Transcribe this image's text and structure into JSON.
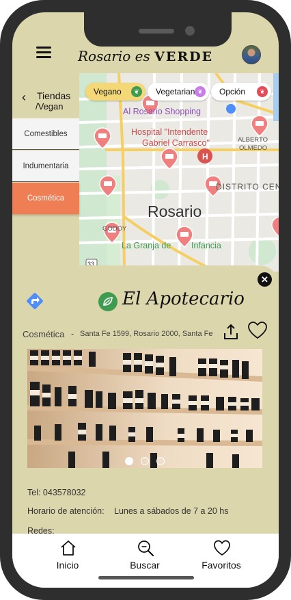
{
  "header": {
    "title_script": "Rosario es",
    "title_bold": "VERDE"
  },
  "filters": [
    {
      "label": "Vegano",
      "color": "#f4d776",
      "icon_color": "#3e9b4f",
      "icon": "leaf-icon"
    },
    {
      "label": "Vegetariano",
      "color": "#ffffff",
      "icon_color": "#c77ce8",
      "icon": "leaf-icon"
    },
    {
      "label": "Opción",
      "color": "#ffffff",
      "icon_color": "#e24b57",
      "icon": "leaf-icon"
    }
  ],
  "sidebar": {
    "back_label": "Tiendas",
    "sub_label": "/Vegan",
    "items": [
      {
        "label": "Comestibles",
        "active": false
      },
      {
        "label": "Indumentaria",
        "active": false
      },
      {
        "label": "Cosmética",
        "active": true
      }
    ]
  },
  "map": {
    "labels": [
      {
        "text": "Al Rosario Shopping",
        "color": "#8c4db3"
      },
      {
        "text": "Hospital \"Intendente",
        "color": "#c94a4a"
      },
      {
        "text": "Gabriel Carrasco\"",
        "color": "#c94a4a"
      },
      {
        "text": "ALBERTO",
        "color": "#555555"
      },
      {
        "text": "OLMEDO",
        "color": "#555555"
      },
      {
        "text": "DISTRITO CEN",
        "color": "#555555"
      },
      {
        "text": "Rosario",
        "color": "#333333"
      },
      {
        "text": "GODOY",
        "color": "#555555"
      },
      {
        "text": "La Granja de",
        "color": "#3e9b4f"
      },
      {
        "text": "Infancia",
        "color": "#3e9b4f"
      },
      {
        "text": "33",
        "color": "#333333"
      }
    ],
    "pin_color": "#f08080",
    "road_color": "#f6cf62"
  },
  "shop": {
    "name": "El Apotecario",
    "category": "Cosmética",
    "separator": "-",
    "address": "Santa Fe 1599, Rosario 2000, Santa Fe",
    "phone": "Tel: 043578032",
    "hours_label": "Horario de atención:",
    "hours_value": "Lunes a sábados de 7 a 20 hs",
    "social_label": "Redes:",
    "photo_count": 3,
    "active_photo": 1
  },
  "bottom_nav": [
    {
      "label": "Inicio",
      "icon": "home-icon"
    },
    {
      "label": "Buscar",
      "icon": "search-icon"
    },
    {
      "label": "Favoritos",
      "icon": "heart-icon"
    }
  ],
  "colors": {
    "background": "#dcd6ad",
    "accent": "#ef7e55",
    "vegan_green": "#3e9b4f",
    "direction_blue": "#4f8ef7"
  }
}
